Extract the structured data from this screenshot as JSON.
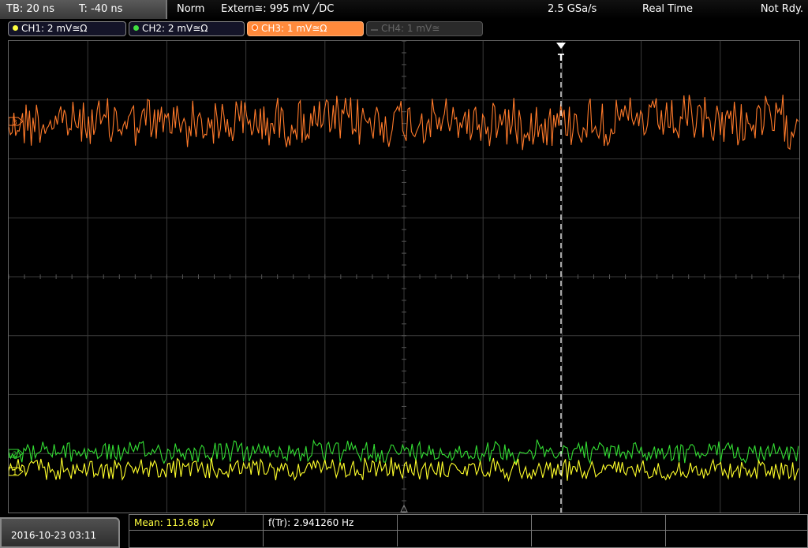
{
  "topbar": {
    "timebase": "TB: 20 ns",
    "trigger_time": "T: -40 ns",
    "trigger_mode": "Norm",
    "trigger_source": "Extern≅: 995 mV ╱DC",
    "sample_rate": "2.5 GSa/s",
    "acquisition_mode": "Real Time",
    "status": "Not Rdy."
  },
  "channels": [
    {
      "label": "CH1: 2 mV≅Ω",
      "color": "#ffff40"
    },
    {
      "label": "CH2: 2 mV≅Ω",
      "color": "#40e040"
    },
    {
      "label": "CH3: 1 mV≅Ω",
      "color": "#ff8a3c"
    },
    {
      "label": "CH4: 1 mV≅",
      "color": "#555555"
    }
  ],
  "waveform_colors": {
    "ch1": "#ffff2a",
    "ch2": "#33dd33",
    "ch3": "#ff7a2a",
    "grid": "#3a3a3a",
    "trigger_marker": "#ffffff"
  },
  "marker_labels": {
    "trigger": "T",
    "ch3_ref": "3",
    "ch2_ref": "2",
    "ch1_ref": "1"
  },
  "bottombar": {
    "datetime": "2016-10-23 03:11",
    "mean": "Mean: 113.68 µV",
    "frequency": "f(Tr): 2.941260 Hz"
  }
}
